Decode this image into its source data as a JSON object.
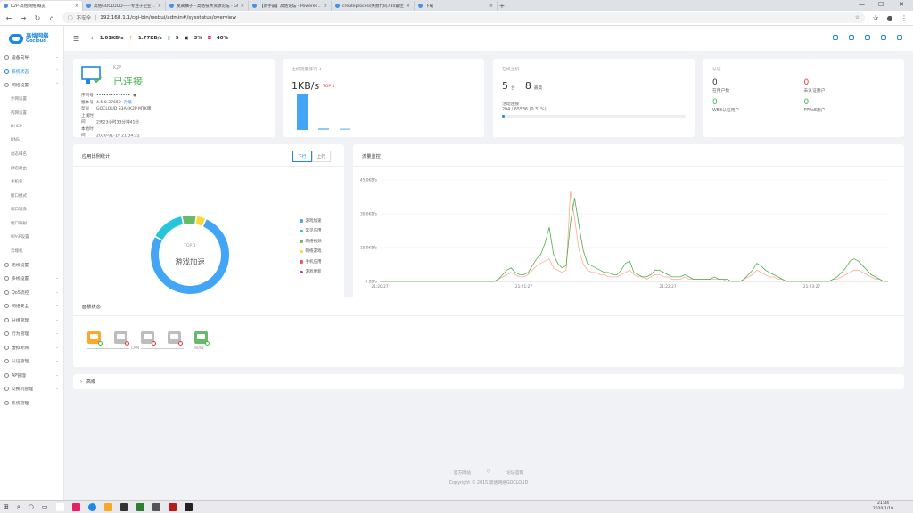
{
  "tabs": [
    {
      "label": "K2P·高恪网络·概览",
      "active": true
    },
    {
      "label": "高恪GOCLOUD——专注于企业...",
      "active": false
    },
    {
      "label": "发飙柚子 - 高恪技术资源论坛 - GO...",
      "active": false
    },
    {
      "label": "【新手篇】高恪论坛 - Powered...",
      "active": false
    },
    {
      "label": "createprocess失败代码740最佳解...",
      "active": false
    },
    {
      "label": "下载",
      "active": false
    }
  ],
  "address": {
    "insecure": "不安全",
    "url": "192.168.1.1/cgi-bin/webui/admin#/sysstatus/overview"
  },
  "brand": {
    "name": "高恪网络",
    "sub": "Gocloud"
  },
  "sidebar": [
    {
      "label": "设备向导",
      "type": "main",
      "chevron": "⌄"
    },
    {
      "label": "系统状态",
      "type": "main",
      "active": true,
      "chevron": "⌃"
    },
    {
      "label": "网络设置",
      "type": "main",
      "chevron": "⌃"
    },
    {
      "label": "外网设置",
      "type": "sub"
    },
    {
      "label": "内网设置",
      "type": "sub"
    },
    {
      "label": "DHCP",
      "type": "sub"
    },
    {
      "label": "DNS",
      "type": "sub"
    },
    {
      "label": "动态域名",
      "type": "sub"
    },
    {
      "label": "静态路由",
      "type": "sub"
    },
    {
      "label": "主机名",
      "type": "sub"
    },
    {
      "label": "接口模式",
      "type": "sub"
    },
    {
      "label": "端口镜像",
      "type": "sub"
    },
    {
      "label": "端口映射",
      "type": "sub"
    },
    {
      "label": "UPnP设置",
      "type": "sub"
    },
    {
      "label": "云端机",
      "type": "sub"
    },
    {
      "label": "无线设置",
      "type": "main",
      "chevron": "⌄"
    },
    {
      "label": "多线设置",
      "type": "main",
      "chevron": "⌄"
    },
    {
      "label": "QoS流控",
      "type": "main",
      "chevron": "⌄"
    },
    {
      "label": "网络安全",
      "type": "main",
      "chevron": "⌄"
    },
    {
      "label": "分组管理",
      "type": "main",
      "chevron": "⌄"
    },
    {
      "label": "行为管理",
      "type": "main",
      "chevron": "⌄"
    },
    {
      "label": "虚拟专网",
      "type": "main",
      "chevron": "⌄"
    },
    {
      "label": "认证管理",
      "type": "main",
      "chevron": "⌄"
    },
    {
      "label": "AP管理",
      "type": "main",
      "chevron": "⌄"
    },
    {
      "label": "交换机管理",
      "type": "main",
      "chevron": "⌄"
    },
    {
      "label": "系统管理",
      "type": "main",
      "chevron": "⌄"
    }
  ],
  "topbar": {
    "up": "1.01KB/s",
    "down": "1.77KB/s",
    "sessions": "5",
    "cpu": "3%",
    "mem": "40%"
  },
  "device": {
    "model_label": "K2P",
    "status": "已连接",
    "rows": [
      {
        "k": "序列号",
        "v": "••••••••••••••"
      },
      {
        "k": "版本号",
        "v": "4.5.0.37650",
        "extra": "升级"
      },
      {
        "k": "型号",
        "v": "GOCLOUD S3A (K2P MTK版)"
      },
      {
        "k": "上线时间",
        "v": "2天23小时33分钟41秒"
      },
      {
        "k": "本地时间",
        "v": "2020-01-19 21:34:22"
      }
    ]
  },
  "traffic_rank": {
    "title": "主机流量排行 ↓",
    "value": "1KB/s",
    "badge": "TOP 1"
  },
  "online": {
    "title": "在线主机",
    "count1": "5",
    "unit1": "台",
    "count2": "8",
    "unit2": "最高",
    "conn_label": "活动连接",
    "conn_value": "204 / 65536 (0.31%)",
    "conn_fraction": 0.0031
  },
  "auth": {
    "title": "认证",
    "items": [
      {
        "value": "0",
        "label": "在用户数",
        "color": "#333"
      },
      {
        "value": "0",
        "label": "未认证用户",
        "color": "#e53935"
      },
      {
        "value": "0",
        "label": "WEB认证用户",
        "color": "#4caf50"
      },
      {
        "value": "0",
        "label": "PPPoE用户",
        "color": "#4caf50"
      }
    ]
  },
  "app_ratio": {
    "title": "应用比例统计",
    "tab_down": "下行",
    "tab_up": "上行",
    "center_top": "TOP 1",
    "center_label": "游戏加速"
  },
  "monitor": {
    "title": "流量监控",
    "legend_down": "下行",
    "legend_up": "上行"
  },
  "ports": {
    "title": "面板状态",
    "lan": "LAN",
    "wan": "WAN"
  },
  "advanced": {
    "label": "高级"
  },
  "footer": {
    "link1": "官方网站",
    "link2": "论坛官网",
    "copyright": "Copyright © 2015 高恪网络GOCLOUD"
  },
  "taskbar": {
    "time": "21:34",
    "date": "2020/1/19"
  },
  "chart_data": [
    {
      "type": "pie",
      "categories": [
        "游戏加速",
        "常见应用",
        "网络视频",
        "网络游戏",
        "手机应用",
        "游戏更新"
      ],
      "values": [
        76,
        14,
        6,
        4,
        0,
        0
      ],
      "colors": [
        "#42a5f5",
        "#26c6da",
        "#66bb6a",
        "#fdd835",
        "#ef5350",
        "#ab47bc"
      ]
    },
    {
      "type": "bar",
      "categories": [
        "1",
        "2",
        "3"
      ],
      "values": [
        1,
        0.05,
        0.04
      ],
      "colors": [
        "#42a5f5",
        "#90caf9",
        "#90caf9"
      ]
    },
    {
      "type": "line",
      "yticks": [
        "0.0B/s",
        "15.0KB/s",
        "30.0KB/s",
        "45.0KB/s"
      ],
      "xticks": [
        "21:20:27",
        "21:21:27",
        "21:22:27",
        "21:23:27"
      ],
      "ylim": [
        0,
        45
      ],
      "series": [
        {
          "name": "下行",
          "color": "#4caf50",
          "values": [
            0,
            0,
            0,
            0,
            0,
            0,
            0,
            0,
            0,
            0,
            0,
            0,
            0,
            0,
            0,
            0,
            0,
            0,
            0,
            0,
            0,
            0,
            0,
            0,
            0,
            0,
            0,
            0,
            1,
            3,
            5,
            6,
            4,
            3,
            3,
            4,
            7,
            10,
            12,
            17,
            24,
            12,
            8,
            6,
            7,
            26,
            37,
            25,
            14,
            8,
            7,
            6,
            5,
            4,
            4,
            3,
            3,
            5,
            8,
            9,
            4,
            3,
            2,
            2,
            3,
            5,
            5,
            4,
            3,
            2,
            2,
            2,
            3,
            2,
            1,
            1,
            1,
            1,
            1,
            2,
            1,
            1,
            1,
            0,
            0,
            0,
            1,
            3,
            5,
            8,
            7,
            5,
            4,
            3,
            2,
            1,
            0,
            0,
            0,
            0,
            0,
            0,
            0,
            0,
            0,
            0,
            0,
            1,
            2,
            4,
            6,
            9,
            10,
            9,
            7,
            5,
            3,
            2,
            1,
            0,
            0
          ]
        },
        {
          "name": "上行",
          "color": "#ffab91",
          "values": [
            0,
            0,
            0,
            0,
            0,
            0,
            0,
            0,
            0,
            0,
            0,
            0,
            0,
            0,
            0,
            0,
            0,
            0,
            0,
            0,
            0,
            0,
            0,
            0,
            0,
            0,
            0,
            0,
            1,
            2,
            3,
            4,
            3,
            2,
            2,
            3,
            5,
            7,
            8,
            9,
            10,
            6,
            5,
            4,
            5,
            40,
            28,
            14,
            8,
            5,
            4,
            4,
            3,
            3,
            2,
            2,
            2,
            3,
            4,
            5,
            3,
            2,
            2,
            1,
            2,
            3,
            3,
            2,
            2,
            1,
            1,
            1,
            2,
            1,
            1,
            1,
            1,
            1,
            1,
            1,
            1,
            1,
            0,
            0,
            0,
            0,
            1,
            2,
            3,
            5,
            4,
            3,
            2,
            2,
            1,
            1,
            0,
            0,
            0,
            0,
            0,
            0,
            0,
            0,
            0,
            0,
            0,
            1,
            1,
            2,
            3,
            4,
            5,
            5,
            4,
            3,
            2,
            1,
            1,
            0,
            0
          ]
        }
      ]
    }
  ]
}
